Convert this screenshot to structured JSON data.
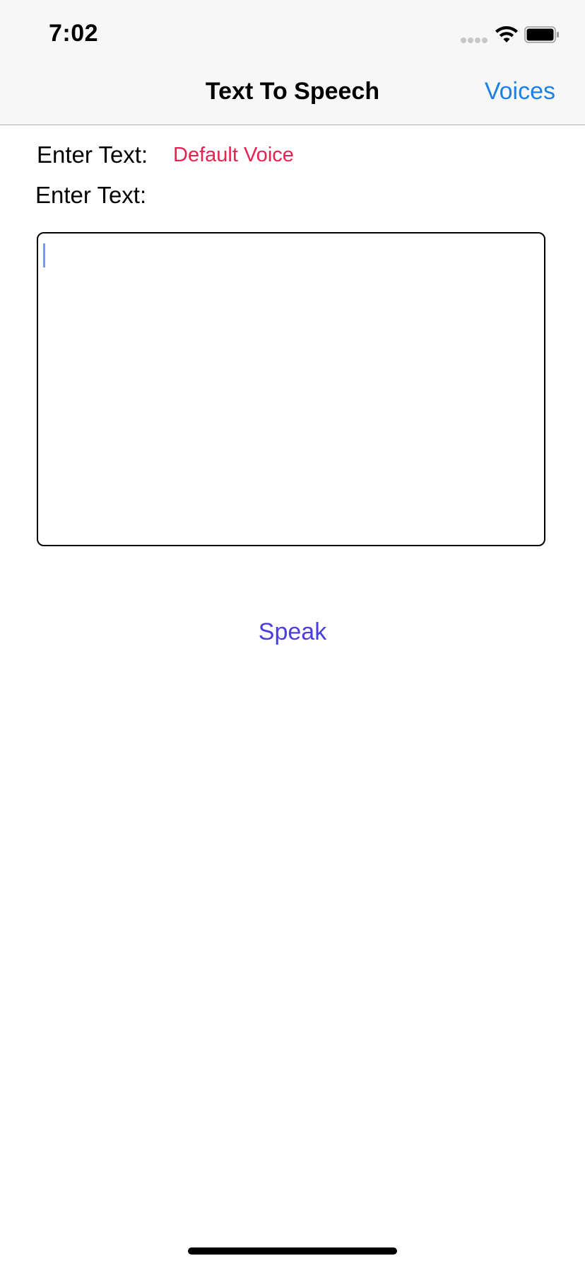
{
  "status_bar": {
    "time": "7:02",
    "icons": [
      "signal-dots-icon",
      "wifi-icon",
      "battery-icon"
    ]
  },
  "nav_bar": {
    "title": "Text To Speech",
    "right_button": "Voices"
  },
  "form": {
    "label_top": "Enter Text:",
    "voice_name": "Default Voice",
    "label_bottom": "Enter Text:",
    "text_value": "",
    "speak_label": "Speak"
  },
  "colors": {
    "nav_link": "#1a82e6",
    "voice_name": "#e8214f",
    "speak": "#4a3ee0",
    "caret": "#7a9be8"
  }
}
